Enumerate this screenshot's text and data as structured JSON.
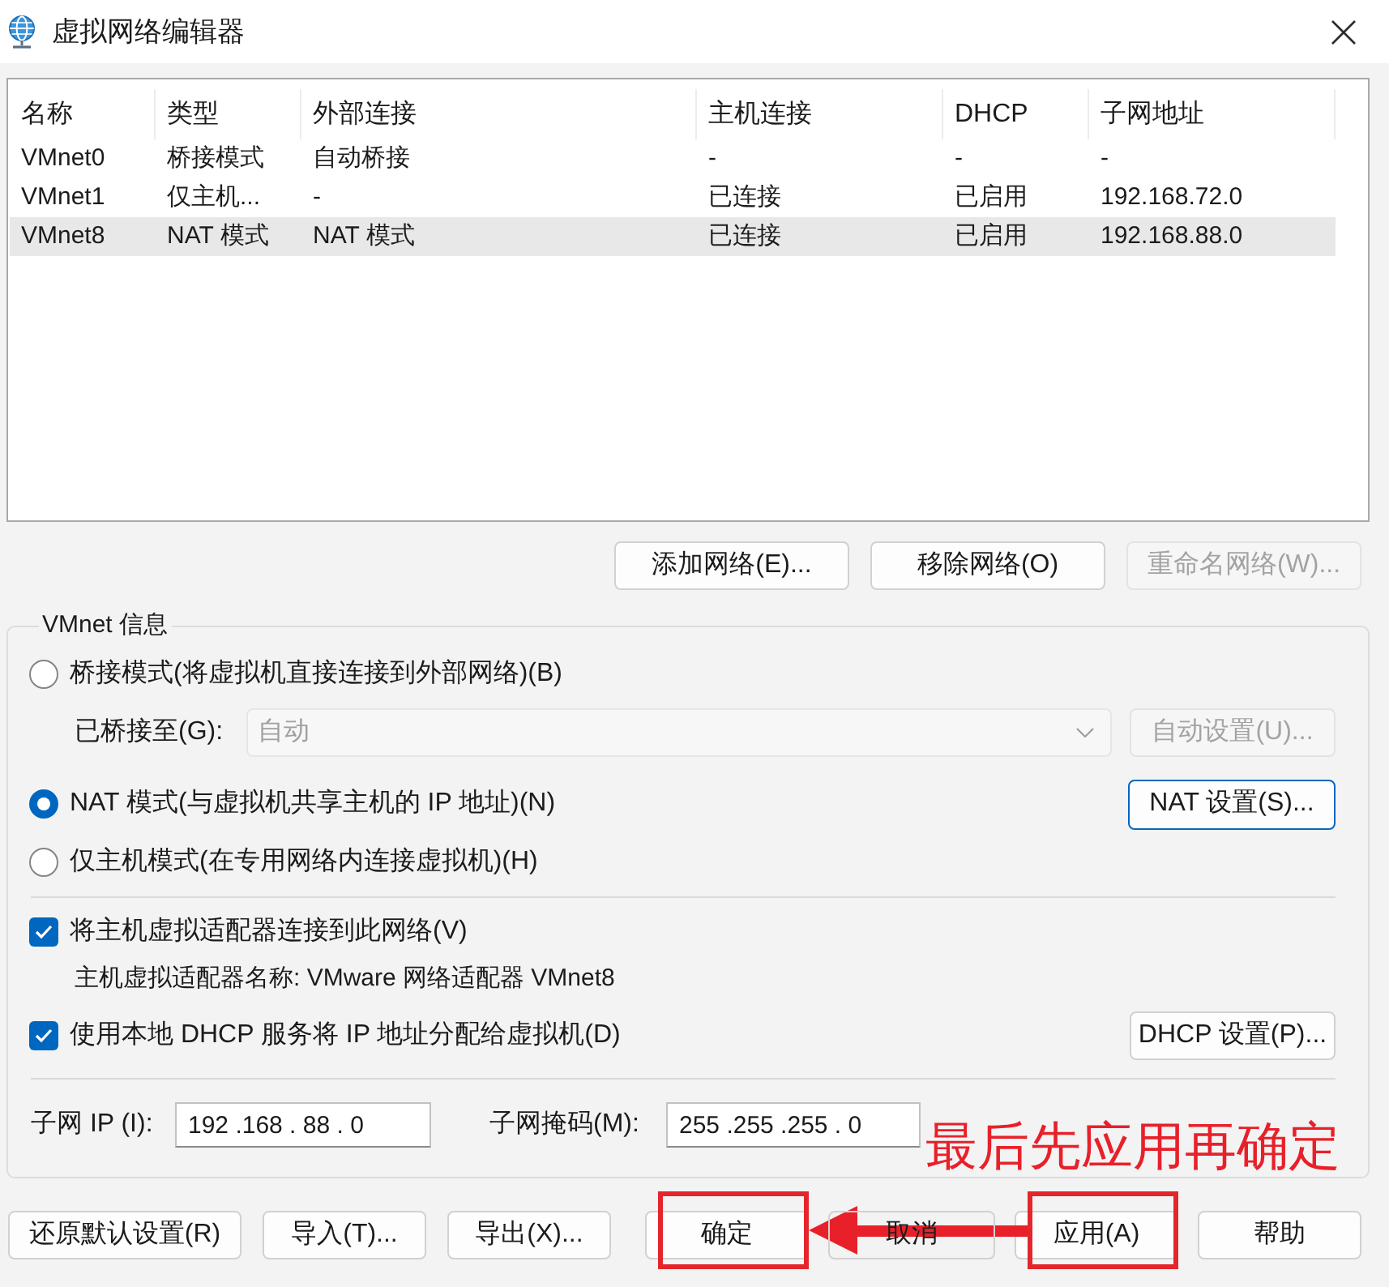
{
  "window": {
    "title": "虚拟网络编辑器"
  },
  "network_table": {
    "columns": [
      "名称",
      "类型",
      "外部连接",
      "主机连接",
      "DHCP",
      "子网地址"
    ],
    "rows": [
      {
        "cells": [
          "VMnet0",
          "桥接模式",
          "自动桥接",
          "-",
          "-",
          "-"
        ],
        "selected": false
      },
      {
        "cells": [
          "VMnet1",
          "仅主机...",
          "-",
          "已连接",
          "已启用",
          "192.168.72.0"
        ],
        "selected": false
      },
      {
        "cells": [
          "VMnet8",
          "NAT 模式",
          "NAT 模式",
          "已连接",
          "已启用",
          "192.168.88.0"
        ],
        "selected": true
      }
    ]
  },
  "network_buttons": [
    {
      "label": "添加网络(E)...",
      "disabled": false
    },
    {
      "label": "移除网络(O)",
      "disabled": false
    },
    {
      "label": "重命名网络(W)...",
      "disabled": true
    }
  ],
  "vmnet_info": {
    "title": "VMnet 信息",
    "modes": [
      {
        "label": "桥接模式(将虚拟机直接连接到外部网络)(B)",
        "selected": false
      },
      {
        "label": "NAT 模式(与虚拟机共享主机的 IP 地址)(N)",
        "selected": true
      },
      {
        "label": "仅主机模式(在专用网络内连接虚拟机)(H)",
        "selected": false
      }
    ],
    "bridged_to": {
      "label": "已桥接至(G):",
      "value": "自动",
      "disabled": true,
      "button": {
        "label": "自动设置(U)...",
        "disabled": true
      }
    },
    "nat_settings_button": {
      "label": "NAT 设置(S)...",
      "default": true
    },
    "options": [
      {
        "label": "将主机虚拟适配器连接到此网络(V)",
        "checked": true
      },
      {
        "label": "使用本地 DHCP 服务将 IP 地址分配给虚拟机(D)",
        "checked": true
      }
    ],
    "adapter_name": "主机虚拟适配器名称: VMware 网络适配器 VMnet8",
    "dhcp_settings_button": {
      "label": "DHCP 设置(P)..."
    },
    "subnet_ip": {
      "label": "子网 IP (I):",
      "value": "192 .168 . 88 . 0"
    },
    "subnet_mask": {
      "label": "子网掩码(M):",
      "value": "255 .255 .255 . 0"
    }
  },
  "annotation": {
    "text": "最后先应用再确定"
  },
  "footer_buttons": {
    "left": [
      {
        "label": "还原默认设置(R)",
        "highlighted": false
      },
      {
        "label": "导入(T)...",
        "highlighted": false
      },
      {
        "label": "导出(X)...",
        "highlighted": false
      }
    ],
    "right": [
      {
        "label": "确定",
        "highlighted": true
      },
      {
        "label": "取消",
        "highlighted": false
      },
      {
        "label": "应用(A)",
        "highlighted": true
      },
      {
        "label": "帮助",
        "highlighted": false
      }
    ]
  }
}
